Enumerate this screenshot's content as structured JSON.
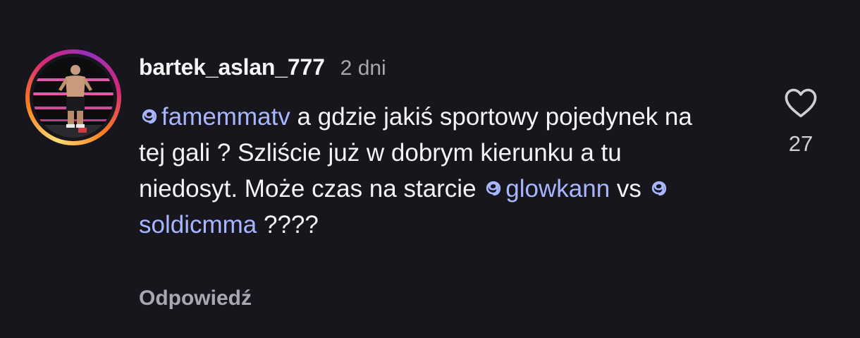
{
  "comment": {
    "username": "bartek_aslan_777",
    "timestamp": "2 dni",
    "segments": [
      {
        "type": "mention",
        "text": "famemmatv"
      },
      {
        "type": "text",
        "text": " a gdzie jakiś sportowy pojedynek na tej gali ? Szliście już w dobrym kierunku a tu  niedosyt. Może czas na starcie "
      },
      {
        "type": "mention",
        "text": "glowkann"
      },
      {
        "type": "text",
        "text": " vs "
      },
      {
        "type": "mention",
        "text": "soldicmma"
      },
      {
        "type": "text",
        "text": " ????"
      }
    ],
    "reply_label": "Odpowiedź",
    "like_count": "27"
  },
  "icons": {
    "avatar": "profile-photo-fighter-in-ring",
    "mention": "threads-at-icon",
    "like": "heart-outline-icon"
  },
  "colors": {
    "background": "#16161c",
    "mention": "#a8b6ff",
    "secondary_text": "#a8a8ad"
  }
}
